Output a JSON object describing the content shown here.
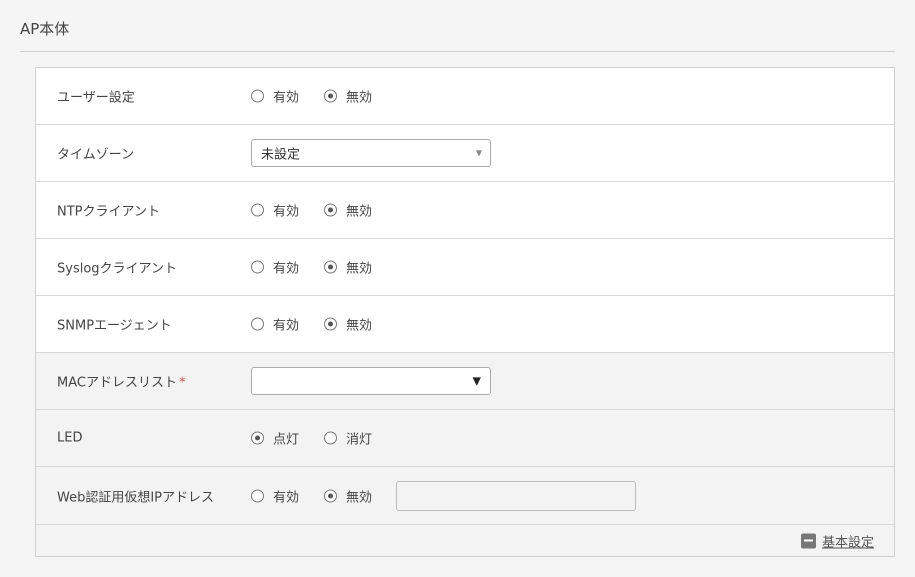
{
  "section": {
    "title": "AP本体"
  },
  "rows": [
    {
      "label": "ユーザー設定",
      "options": [
        "有効",
        "無効"
      ],
      "selected": 1
    },
    {
      "label": "タイムゾーン",
      "select_value": "未設定"
    },
    {
      "label": "NTPクライアント",
      "options": [
        "有効",
        "無効"
      ],
      "selected": 1
    },
    {
      "label": "Syslogクライアント",
      "options": [
        "有効",
        "無効"
      ],
      "selected": 1
    },
    {
      "label": "SNMPエージェント",
      "options": [
        "有効",
        "無効"
      ],
      "selected": 1
    },
    {
      "label": "MACアドレスリスト",
      "required_mark": "*",
      "select_value": ""
    },
    {
      "label": "LED",
      "options": [
        "点灯",
        "消灯"
      ],
      "selected": 0
    },
    {
      "label": "Web認証用仮想IPアドレス",
      "options": [
        "有効",
        "無効"
      ],
      "selected": 1,
      "input_value": ""
    }
  ],
  "footer": {
    "link_label": "基本設定",
    "icon": "minus-square-icon"
  }
}
